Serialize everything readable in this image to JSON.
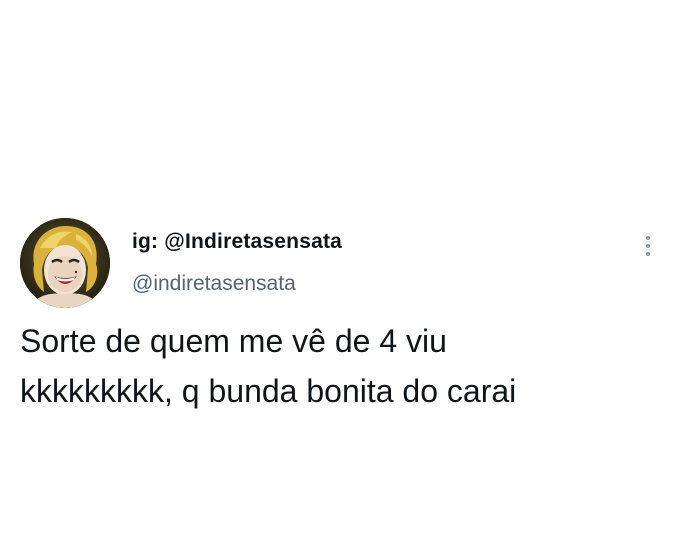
{
  "tweet": {
    "display_name": "ig: @Indiretasensata",
    "handle": "@indiretasensata",
    "text_lines": [
      "Sorte de quem me vê de 4 viu",
      "kkkkkkkkk, q bunda bonita do carai"
    ],
    "avatar_icon": "marilyn-portrait-avatar",
    "more_icon": "more-vertical-icon"
  },
  "colors": {
    "background": "#ffffff",
    "text": "#0f1419",
    "secondary_text": "#536471",
    "more_icon": "#8b98a5"
  }
}
